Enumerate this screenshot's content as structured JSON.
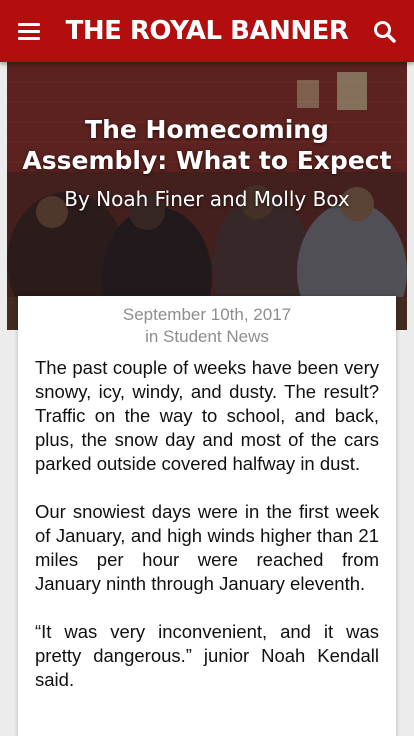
{
  "header": {
    "brand": "THE ROYAL BANNER",
    "menu_icon": "hamburger-menu-icon",
    "search_icon": "search-icon",
    "background_color": "#b30d0d"
  },
  "hero": {
    "title": "The Homecoming Assembly: What to Expect",
    "byline": "By Noah Finer and Molly Box"
  },
  "article": {
    "date": "September 10th, 2017",
    "category_line": "in Student News",
    "paragraphs": [
      "The past couple of weeks have been very snowy, icy, windy, and dusty. The result? Traffic on the way to school, and back, plus, the snow day and most of the cars parked outside covered halfway in dust.",
      "Our snowiest days were in the first week of January, and high winds higher than 21 miles per hour were reached from January ninth through January eleventh.",
      "“It was very inconvenient, and it was pretty dangerous.” junior  Noah Kendall said."
    ]
  }
}
